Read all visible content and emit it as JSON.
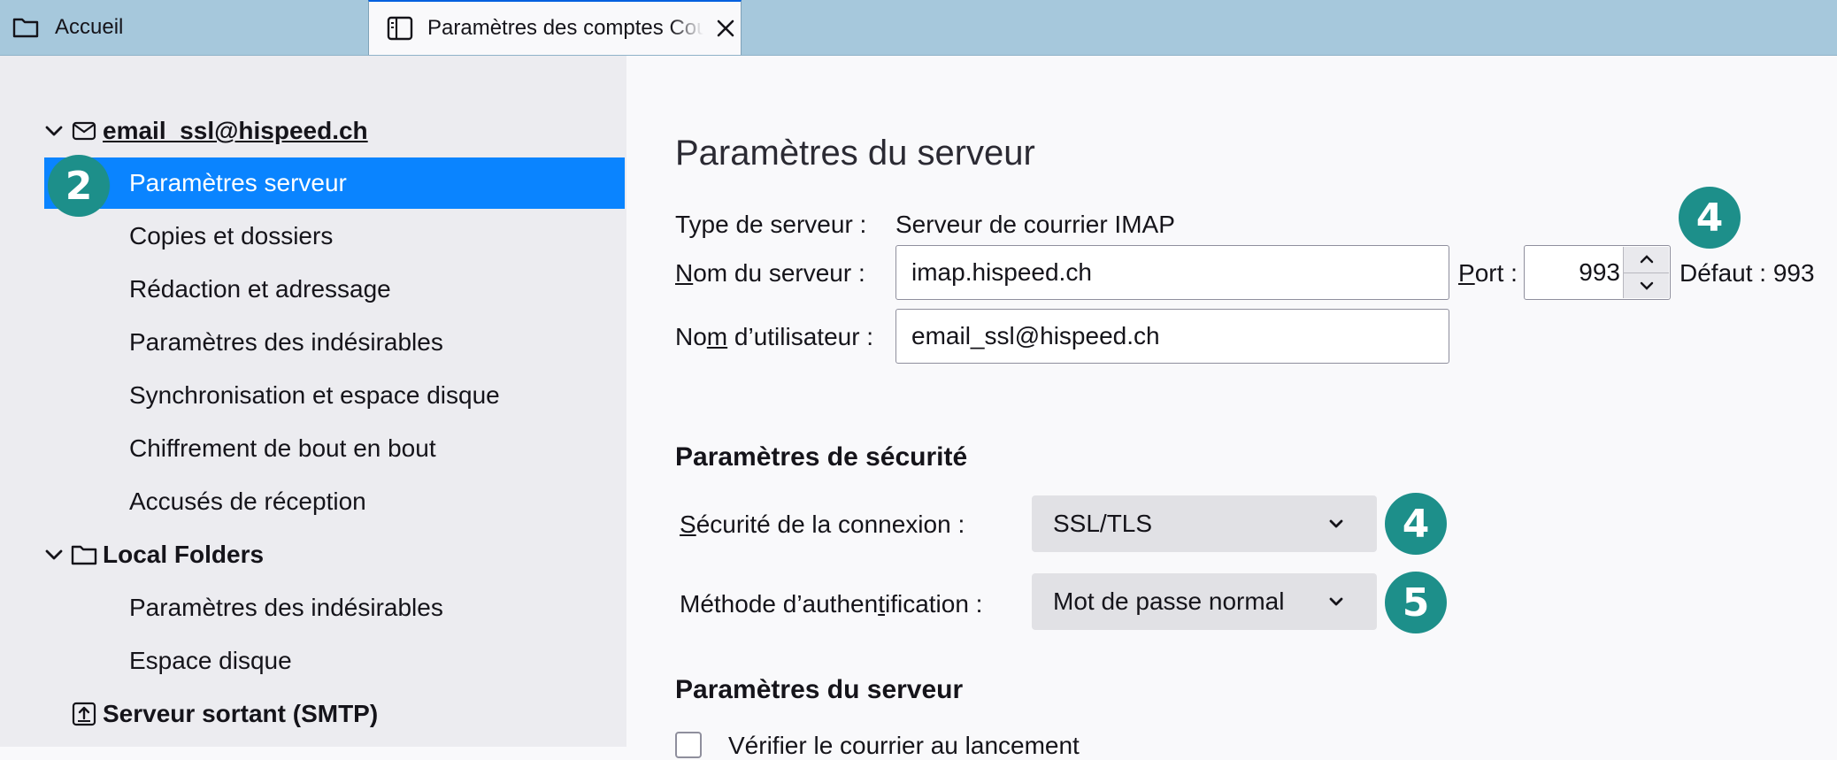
{
  "tabs": {
    "home": {
      "label": "Accueil",
      "icon": "folder-icon"
    },
    "active": {
      "label": "Paramètres des comptes Courrier",
      "icon": "account-settings-icon",
      "close_icon": "close-icon"
    }
  },
  "sidebar": {
    "account": {
      "label": "email_ssl@hispeed.ch",
      "icon": "envelope-icon"
    },
    "account_items": [
      {
        "label": "Paramètres serveur",
        "selected": true
      },
      {
        "label": "Copies et dossiers"
      },
      {
        "label": "Rédaction et adressage"
      },
      {
        "label": "Paramètres des indésirables"
      },
      {
        "label": "Synchronisation et espace disque"
      },
      {
        "label": "Chiffrement de bout en bout"
      },
      {
        "label": "Accusés de réception"
      }
    ],
    "local": {
      "label": "Local Folders",
      "icon": "folder-icon"
    },
    "local_items": [
      {
        "label": "Paramètres des indésirables"
      },
      {
        "label": "Espace disque"
      }
    ],
    "smtp": {
      "label": "Serveur sortant (SMTP)",
      "icon": "outgoing-server-icon"
    }
  },
  "main": {
    "title": "Paramètres du serveur",
    "server_type_label": "Type de serveur :",
    "server_type_value": "Serveur de courrier IMAP",
    "server_name_label_u": "N",
    "server_name_label_rest": "om du serveur :",
    "server_name_value": "imap.hispeed.ch",
    "port_label_u": "P",
    "port_label_rest": "ort :",
    "port_value": "993",
    "default_port": "Défaut : 993",
    "username_label_a": "No",
    "username_label_u": "m",
    "username_label_b": " d’utilisateur :",
    "username_value": "email_ssl@hispeed.ch",
    "security_heading": "Paramètres de sécurité",
    "connection_security_label_u": "S",
    "connection_security_label_rest": "écurité de la connexion :",
    "connection_security_value": "SSL/TLS",
    "auth_method_label_a": "Méthode d’authen",
    "auth_method_label_u": "t",
    "auth_method_label_b": "ification :",
    "auth_method_value": "Mot de passe normal",
    "server_heading": "Paramètres du serveur",
    "check_on_startup_label": "Vérifier le courrier au lancement"
  },
  "badges": {
    "badge_sidebar": "2",
    "badge_port": "4",
    "badge_security": "4",
    "badge_auth": "5"
  },
  "colors": {
    "accent": "#0a84ff",
    "badge": "#1d8f8a",
    "tabbar": "#a6c8dc"
  }
}
